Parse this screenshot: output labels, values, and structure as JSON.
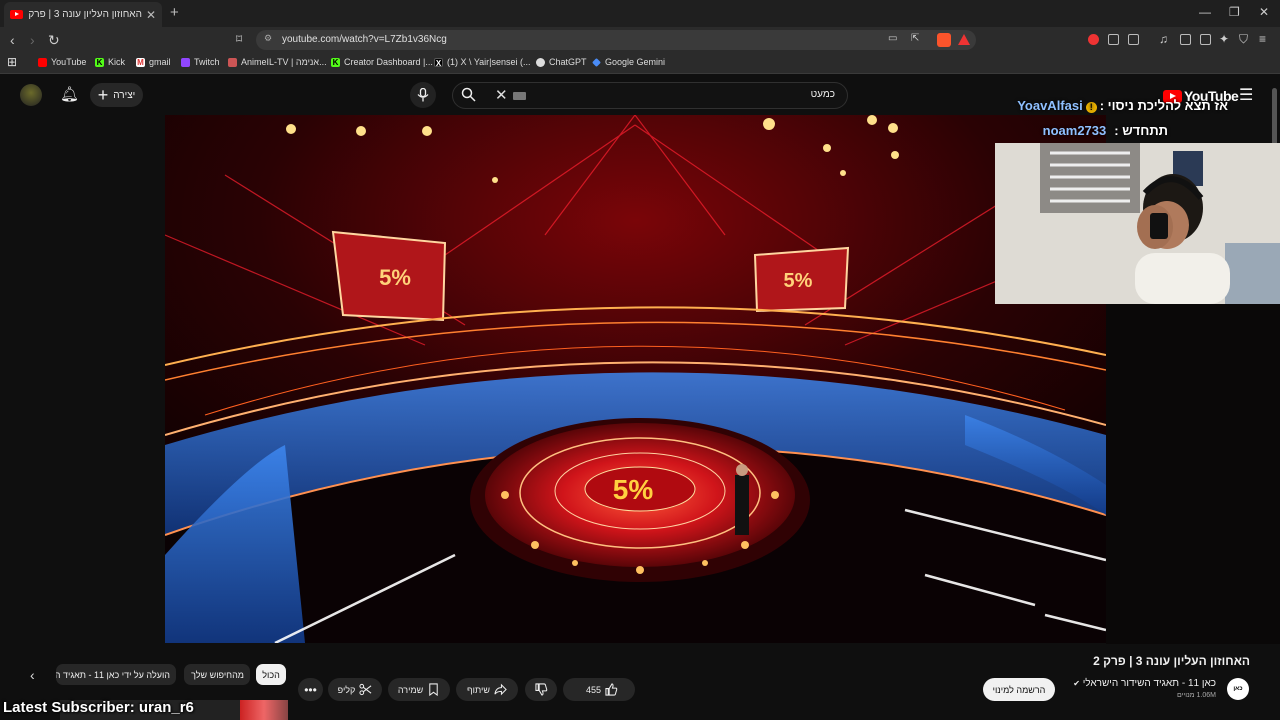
{
  "browser": {
    "tab_title": "האחוזון העליון עונה 3 | פרק 2 - ...",
    "url": "youtube.com/watch?v=L7Zb1v36Ncg",
    "bookmarks": [
      "YouTube",
      "Kick",
      "gmail",
      "Twitch",
      "AnimeIL-TV | אנימה...",
      "Creator Dashboard |...",
      "(1) X \\ Yair|sensei (...",
      "ChatGPT",
      "Google Gemini"
    ]
  },
  "masthead": {
    "create_label": "יצירה",
    "search_query": "כמעט",
    "logo_text": "YouTube"
  },
  "overlay": {
    "chat1_name": "YoavAlfasi",
    "chat1_text": "אז תצא להליכת ניסוי :",
    "chat2_name": "noam2733",
    "chat2_text": "תתחדש :",
    "latest_subscriber": "Latest Subscriber: uran_r6"
  },
  "video": {
    "screen_text": "5%",
    "title": "האחוזון העליון עונה 3 | פרק 2",
    "channel_name": "כאן 11 - תאגיד השידור הישראלי",
    "channel_avatar_text": "כאן",
    "subscribers": "1.06M מנויים",
    "subscribe_label": "הרשמה למינוי",
    "like_count": "455",
    "share_label": "שיתוף",
    "save_label": "שמירה",
    "clip_label": "קליפ"
  },
  "chips": {
    "all": "הכול",
    "from_search": "מהחיפוש שלך",
    "uploaded_by": "הועלה על ידי כאן 11 - תאגיד ה"
  },
  "colors": {
    "youtube_red": "#ff0000",
    "stage_red": "#c8141a",
    "audience_blue": "#2a6fd6"
  }
}
